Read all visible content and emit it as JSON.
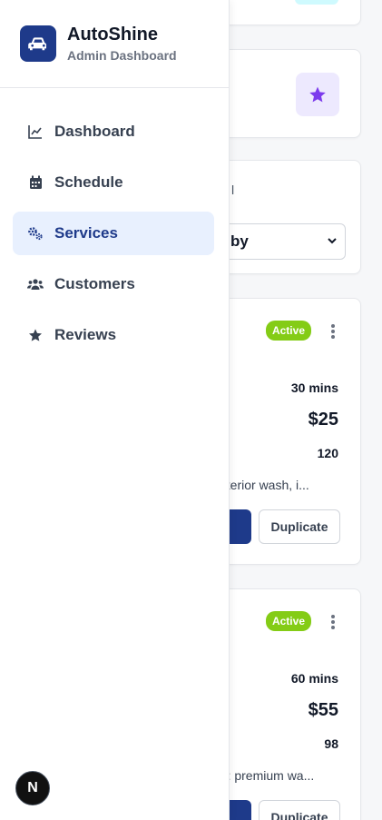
{
  "brand": {
    "title": "AutoShine",
    "subtitle": "Admin Dashboard",
    "logo_icon": "car-icon",
    "color": "#1e3a8a"
  },
  "nav": {
    "items": [
      {
        "label": "Dashboard",
        "icon": "chart-line-icon",
        "active": false
      },
      {
        "label": "Schedule",
        "icon": "calendar-icon",
        "active": false
      },
      {
        "label": "Services",
        "icon": "cogs-icon",
        "active": true
      },
      {
        "label": "Customers",
        "icon": "users-icon",
        "active": false
      },
      {
        "label": "Reviews",
        "icon": "star-icon",
        "active": false
      }
    ]
  },
  "background": {
    "filter": {
      "label_fragment": "l",
      "select_value_fragment": "by"
    },
    "services": [
      {
        "status": "Active",
        "duration": "30 mins",
        "price": "$25",
        "count": "120",
        "description_fragment": "exterior wash, i...",
        "duplicate_label": "Duplicate"
      },
      {
        "status": "Active",
        "duration": "60 mins",
        "price": "$55",
        "count": "98",
        "description_fragment": "on: premium wa...",
        "duplicate_label": "Duplicate"
      }
    ]
  },
  "next_badge": {
    "label": "N"
  },
  "colors": {
    "accent": "#1e3a8a",
    "active_nav_bg": "#e8f0fe",
    "status_active": "#84cc16",
    "star_purple": "#7c3aed"
  }
}
